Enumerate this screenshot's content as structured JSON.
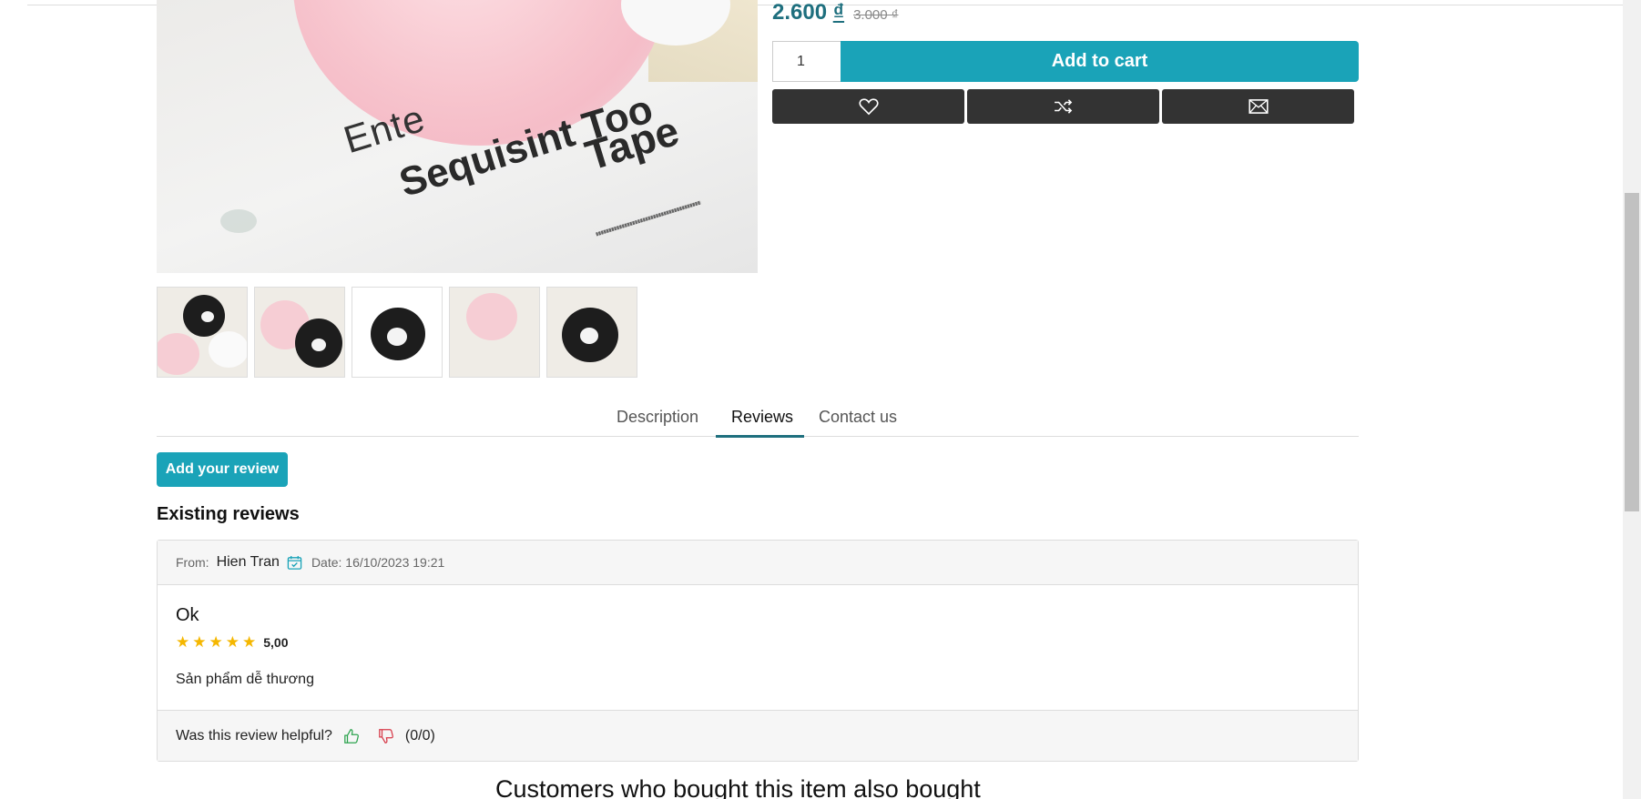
{
  "product": {
    "image_text": {
      "line1": "Ente",
      "line2": "Sequisint Too",
      "line3": "Tape"
    },
    "thumbnails": [
      "thumb-1",
      "thumb-2",
      "thumb-3",
      "thumb-4",
      "thumb-5"
    ],
    "price_new": "2.600",
    "price_currency": "₫",
    "price_old": "3.000 ₫",
    "quantity": "1",
    "add_to_cart_label": "Add to cart",
    "action_icons": [
      "heart-icon",
      "shuffle-icon",
      "envelope-icon"
    ]
  },
  "tabs": [
    {
      "label": "Description",
      "active": false
    },
    {
      "label": "Reviews",
      "active": true
    },
    {
      "label": "Contact us",
      "active": false
    }
  ],
  "reviews_section": {
    "add_review_label": "Add your review",
    "existing_title": "Existing reviews",
    "review": {
      "from_label": "From:",
      "author": "Hien Tran",
      "date_label": "Date: 16/10/2023 19:21",
      "title": "Ok",
      "stars": 5,
      "rating": "5,00",
      "text": "Sản phẩm dễ thương",
      "helpful_label": "Was this review helpful?",
      "helpful_count": "(0/0)"
    }
  },
  "also_bought_title": "Customers who bought this item also bought",
  "colors": {
    "accent": "#1aa3b8",
    "price": "#1e6f7e",
    "dark_button": "#333333",
    "star": "#f5b700"
  }
}
